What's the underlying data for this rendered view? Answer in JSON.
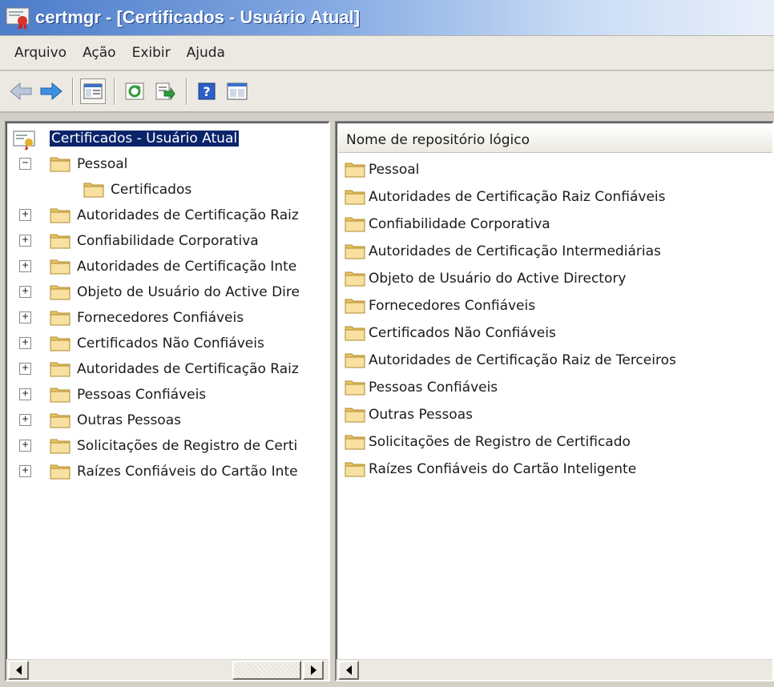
{
  "window": {
    "title": "certmgr - [Certificados - Usuário Atual]"
  },
  "menu": [
    "Arquivo",
    "Ação",
    "Exibir",
    "Ajuda"
  ],
  "toolbar": {
    "icons": [
      "back-arrow-icon",
      "forward-arrow-icon",
      "show-hide-tree-icon",
      "refresh-icon",
      "export-list-icon",
      "help-icon",
      "properties-icon"
    ]
  },
  "tree": {
    "root": "Certificados - Usuário Atual",
    "items": [
      {
        "label": "Pessoal",
        "expander": "−",
        "level": 1
      },
      {
        "label": "Certificados",
        "expander": "",
        "level": 2
      },
      {
        "label": "Autoridades de Certificação Raiz",
        "expander": "+",
        "level": 1
      },
      {
        "label": "Confiabilidade Corporativa",
        "expander": "+",
        "level": 1
      },
      {
        "label": "Autoridades de Certificação Inte",
        "expander": "+",
        "level": 1
      },
      {
        "label": "Objeto de Usuário do Active Dire",
        "expander": "+",
        "level": 1
      },
      {
        "label": "Fornecedores Confiáveis",
        "expander": "+",
        "level": 1
      },
      {
        "label": "Certificados Não Confiáveis",
        "expander": "+",
        "level": 1
      },
      {
        "label": "Autoridades de Certificação Raiz",
        "expander": "+",
        "level": 1
      },
      {
        "label": "Pessoas Confiáveis",
        "expander": "+",
        "level": 1
      },
      {
        "label": "Outras Pessoas",
        "expander": "+",
        "level": 1
      },
      {
        "label": "Solicitações de Registro de Certi",
        "expander": "+",
        "level": 1
      },
      {
        "label": "Raízes Confiáveis do Cartão Inte",
        "expander": "+",
        "level": 1
      }
    ]
  },
  "list": {
    "column_header": "Nome de repositório lógico",
    "items": [
      "Pessoal",
      "Autoridades de Certificação Raiz Confiáveis",
      "Confiabilidade Corporativa",
      "Autoridades de Certificação Intermediárias",
      "Objeto de Usuário do Active Directory",
      "Fornecedores Confiáveis",
      "Certificados Não Confiáveis",
      "Autoridades de Certificação Raiz de Terceiros",
      "Pessoas Confiáveis",
      "Outras Pessoas",
      "Solicitações de Registro de Certificado",
      "Raízes Confiáveis do Cartão Inteligente"
    ]
  },
  "colors": {
    "selection": "#0a246a",
    "folder": "#f2d27a"
  }
}
